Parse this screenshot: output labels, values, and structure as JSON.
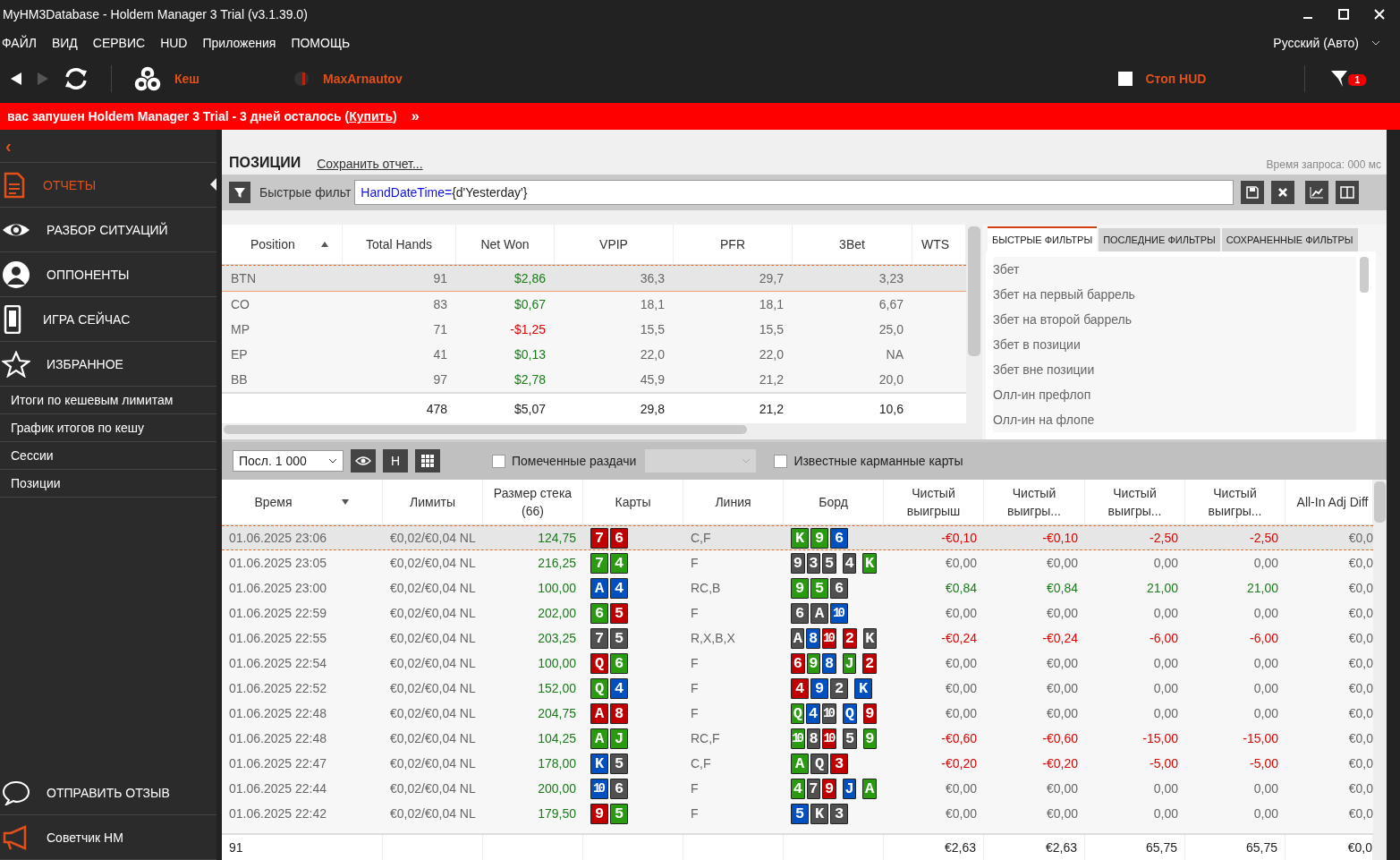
{
  "window": {
    "title": "MyHM3Database - Holdem Manager 3 Trial (v3.1.39.0)"
  },
  "menu": [
    "ФАЙЛ",
    "ВИД",
    "СЕРВИС",
    "HUD",
    "Приложения",
    "ПОМОЩЬ"
  ],
  "language": "Русский (Авто)",
  "toolbar": {
    "game_type": "Кеш",
    "player": "MaxArnautov",
    "stop_hud": {
      "label": "Стоп HUD",
      "checked": false
    },
    "filter_badge": "1"
  },
  "banner": {
    "text": "вас запушен Holdem Manager 3 Trial - 3 дней осталось (",
    "link": "Купить",
    "suffix": ")",
    "more": "»"
  },
  "sidebar": {
    "back": "‹",
    "items": [
      {
        "label": "ОТЧЕТЫ",
        "selected": true
      },
      {
        "label": "РАЗБОР СИТУАЦИЙ",
        "selected": false
      },
      {
        "label": "ОППОНЕНТЫ",
        "selected": false
      },
      {
        "label": "ИГРА СЕЙЧАС",
        "selected": false
      },
      {
        "label": "ИЗБРАННОЕ",
        "selected": false
      }
    ],
    "reports": [
      {
        "label": "Итоги по кешевым лимитам",
        "selected": false
      },
      {
        "label": "График итогов по кешу",
        "selected": false
      },
      {
        "label": "Сессии",
        "selected": false
      },
      {
        "label": "Позиции",
        "selected": false
      }
    ],
    "bottom": [
      {
        "label": "ОТПРАВИТЬ ОТЗЫВ"
      },
      {
        "label": "Советчик HM"
      }
    ]
  },
  "report": {
    "title": "ПОЗИЦИИ",
    "save_link": "Сохранить отчет...",
    "query_time": "Время запроса: 000 мс",
    "filter": {
      "label": "Быстрые фильт",
      "field": "HandDateTime=",
      "value": " {d'Yesterday'}"
    }
  },
  "positions": {
    "columns": [
      {
        "label": "Position",
        "sorted": true,
        "descending": false
      },
      {
        "label": "Total Hands"
      },
      {
        "label": "Net Won"
      },
      {
        "label": "VPIP"
      },
      {
        "label": "PFR"
      },
      {
        "label": "3Bet"
      },
      {
        "label": "WTS"
      }
    ],
    "rows": [
      {
        "position": "BTN",
        "total_hands": "91",
        "net_won": "$2,86",
        "vpip": "36,3",
        "pfr": "29,7",
        "three_bet": "3,23",
        "color": "#1a7a1a",
        "selected": true
      },
      {
        "position": "CO",
        "total_hands": "83",
        "net_won": "$0,67",
        "vpip": "18,1",
        "pfr": "18,1",
        "three_bet": "6,67",
        "color": "#1a7a1a",
        "selected": false
      },
      {
        "position": "MP",
        "total_hands": "71",
        "net_won": "-$1,25",
        "vpip": "15,5",
        "pfr": "15,5",
        "three_bet": "25,0",
        "color": "#e00000",
        "selected": false
      },
      {
        "position": "EP",
        "total_hands": "41",
        "net_won": "$0,13",
        "vpip": "22,0",
        "pfr": "22,0",
        "three_bet": "NA",
        "color": "#1a7a1a",
        "selected": false
      },
      {
        "position": "BB",
        "total_hands": "97",
        "net_won": "$2,78",
        "vpip": "45,9",
        "pfr": "21,2",
        "three_bet": "20,0",
        "color": "#1a7a1a",
        "selected": false
      }
    ],
    "totals": {
      "total_hands": "478",
      "net_won": "$5,07",
      "vpip": "29,8",
      "pfr": "21,2",
      "three_bet": "10,6"
    }
  },
  "filter_panel": {
    "tabs": [
      {
        "label": "БЫСТРЫЕ ФИЛЬТРЫ",
        "selected": true
      },
      {
        "label": "ПОСЛЕДНИЕ ФИЛЬТРЫ",
        "selected": false
      },
      {
        "label": "СОХРАНЕННЫЕ ФИЛЬТРЫ",
        "selected": false
      }
    ],
    "items": [
      "3бет",
      "3бет на первый баррель",
      "3бет на второй баррель",
      "3бет в позиции",
      "3бет вне позиции",
      "Олл-ин префлоп",
      "Олл-ин на флопе"
    ]
  },
  "hands_toolbar": {
    "range": "Посл. 1 000",
    "h_button": "H",
    "marked": {
      "label": "Помеченные раздачи",
      "checked": false
    },
    "known_cards": {
      "label": "Известные карманные карты",
      "checked": false
    }
  },
  "hands": {
    "columns": [
      {
        "label": "Время",
        "sorted": true,
        "descending": true
      },
      {
        "label": "Лимиты"
      },
      {
        "label": "Размер стека (66)"
      },
      {
        "label": "Карты"
      },
      {
        "label": "Линия"
      },
      {
        "label": "Борд"
      },
      {
        "label": "Чистый выигрыш"
      },
      {
        "label": "Чистый выигры..."
      },
      {
        "label": "Чистый выигры..."
      },
      {
        "label": "Чистый выигры..."
      },
      {
        "label": "All-In Adj Diff"
      }
    ],
    "rows": [
      {
        "time": "01.06.2025 23:06",
        "limits": "€0,02/€0,04 NL",
        "stack": "124,75",
        "hole_cards": [
          {
            "rank": "7",
            "color": "#c00000"
          },
          {
            "rank": "6",
            "color": "#c00000"
          }
        ],
        "line": "C,F",
        "board": [
          {
            "rank": "K",
            "color": "#2a9a10"
          },
          {
            "rank": "9",
            "color": "#2a9a10"
          },
          {
            "rank": "6",
            "color": "#0050c0"
          }
        ],
        "net_won": [
          "-€0,10",
          "-€0,10",
          "-2,50",
          "-2,50"
        ],
        "all_in_adj_diff": "€0,0",
        "color": "#e00000",
        "selected": true
      },
      {
        "time": "01.06.2025 23:05",
        "limits": "€0,02/€0,04 NL",
        "stack": "216,25",
        "hole_cards": [
          {
            "rank": "7",
            "color": "#2a9a10"
          },
          {
            "rank": "4",
            "color": "#2a9a10"
          }
        ],
        "line": "F",
        "board": [
          {
            "rank": "9",
            "color": "#505050"
          },
          {
            "rank": "3",
            "color": "#505050"
          },
          {
            "rank": "5",
            "color": "#505050"
          },
          {
            "rank": "4",
            "color": "#505050"
          },
          {
            "rank": "K",
            "color": "#2a9a10"
          }
        ],
        "net_won": [
          "€0,00",
          "€0,00",
          "0,00",
          "0,00"
        ],
        "all_in_adj_diff": "€0,0",
        "color": "#666666",
        "selected": false
      },
      {
        "time": "01.06.2025 23:00",
        "limits": "€0,02/€0,04 NL",
        "stack": "100,00",
        "hole_cards": [
          {
            "rank": "A",
            "color": "#0050c0"
          },
          {
            "rank": "4",
            "color": "#0050c0"
          }
        ],
        "line": "RC,B",
        "board": [
          {
            "rank": "9",
            "color": "#2a9a10"
          },
          {
            "rank": "5",
            "color": "#2a9a10"
          },
          {
            "rank": "6",
            "color": "#505050"
          }
        ],
        "net_won": [
          "€0,84",
          "€0,84",
          "21,00",
          "21,00"
        ],
        "all_in_adj_diff": "€0,0",
        "color": "#1a7a1a",
        "selected": false
      },
      {
        "time": "01.06.2025 22:59",
        "limits": "€0,02/€0,04 NL",
        "stack": "202,00",
        "hole_cards": [
          {
            "rank": "6",
            "color": "#2a9a10"
          },
          {
            "rank": "5",
            "color": "#c00000"
          }
        ],
        "line": "F",
        "board": [
          {
            "rank": "6",
            "color": "#505050"
          },
          {
            "rank": "A",
            "color": "#505050"
          },
          {
            "rank": "10",
            "color": "#0050c0"
          }
        ],
        "net_won": [
          "€0,00",
          "€0,00",
          "0,00",
          "0,00"
        ],
        "all_in_adj_diff": "€0,0",
        "color": "#666666",
        "selected": false
      },
      {
        "time": "01.06.2025 22:55",
        "limits": "€0,02/€0,04 NL",
        "stack": "203,25",
        "hole_cards": [
          {
            "rank": "7",
            "color": "#505050"
          },
          {
            "rank": "5",
            "color": "#505050"
          }
        ],
        "line": "R,X,B,X",
        "board": [
          {
            "rank": "A",
            "color": "#505050"
          },
          {
            "rank": "8",
            "color": "#0050c0"
          },
          {
            "rank": "10",
            "color": "#c00000"
          },
          {
            "rank": "2",
            "color": "#c00000"
          },
          {
            "rank": "K",
            "color": "#505050"
          }
        ],
        "net_won": [
          "-€0,24",
          "-€0,24",
          "-6,00",
          "-6,00"
        ],
        "all_in_adj_diff": "€0,0",
        "color": "#e00000",
        "selected": false
      },
      {
        "time": "01.06.2025 22:54",
        "limits": "€0,02/€0,04 NL",
        "stack": "100,00",
        "hole_cards": [
          {
            "rank": "Q",
            "color": "#c00000"
          },
          {
            "rank": "6",
            "color": "#2a9a10"
          }
        ],
        "line": "F",
        "board": [
          {
            "rank": "6",
            "color": "#c00000"
          },
          {
            "rank": "9",
            "color": "#2a9a10"
          },
          {
            "rank": "8",
            "color": "#0050c0"
          },
          {
            "rank": "J",
            "color": "#2a9a10"
          },
          {
            "rank": "2",
            "color": "#c00000"
          }
        ],
        "net_won": [
          "€0,00",
          "€0,00",
          "0,00",
          "0,00"
        ],
        "all_in_adj_diff": "€0,0",
        "color": "#666666",
        "selected": false
      },
      {
        "time": "01.06.2025 22:52",
        "limits": "€0,02/€0,04 NL",
        "stack": "152,00",
        "hole_cards": [
          {
            "rank": "Q",
            "color": "#2a9a10"
          },
          {
            "rank": "4",
            "color": "#0050c0"
          }
        ],
        "line": "F",
        "board": [
          {
            "rank": "4",
            "color": "#c00000"
          },
          {
            "rank": "9",
            "color": "#0050c0"
          },
          {
            "rank": "2",
            "color": "#505050"
          },
          {
            "rank": "K",
            "color": "#0050c0"
          }
        ],
        "net_won": [
          "€0,00",
          "€0,00",
          "0,00",
          "0,00"
        ],
        "all_in_adj_diff": "€0,0",
        "color": "#666666",
        "selected": false
      },
      {
        "time": "01.06.2025 22:48",
        "limits": "€0,02/€0,04 NL",
        "stack": "204,75",
        "hole_cards": [
          {
            "rank": "A",
            "color": "#c00000"
          },
          {
            "rank": "8",
            "color": "#c00000"
          }
        ],
        "line": "F",
        "board": [
          {
            "rank": "Q",
            "color": "#2a9a10"
          },
          {
            "rank": "4",
            "color": "#0050c0"
          },
          {
            "rank": "10",
            "color": "#505050"
          },
          {
            "rank": "Q",
            "color": "#0050c0"
          },
          {
            "rank": "9",
            "color": "#c00000"
          }
        ],
        "net_won": [
          "€0,00",
          "€0,00",
          "0,00",
          "0,00"
        ],
        "all_in_adj_diff": "€0,0",
        "color": "#666666",
        "selected": false
      },
      {
        "time": "01.06.2025 22:48",
        "limits": "€0,02/€0,04 NL",
        "stack": "104,25",
        "hole_cards": [
          {
            "rank": "A",
            "color": "#2a9a10"
          },
          {
            "rank": "J",
            "color": "#2a9a10"
          }
        ],
        "line": "RC,F",
        "board": [
          {
            "rank": "10",
            "color": "#2a9a10"
          },
          {
            "rank": "8",
            "color": "#505050"
          },
          {
            "rank": "10",
            "color": "#c00000"
          },
          {
            "rank": "5",
            "color": "#505050"
          },
          {
            "rank": "9",
            "color": "#2a9a10"
          }
        ],
        "net_won": [
          "-€0,60",
          "-€0,60",
          "-15,00",
          "-15,00"
        ],
        "all_in_adj_diff": "€0,0",
        "color": "#e00000",
        "selected": false
      },
      {
        "time": "01.06.2025 22:47",
        "limits": "€0,02/€0,04 NL",
        "stack": "178,00",
        "hole_cards": [
          {
            "rank": "K",
            "color": "#0050c0"
          },
          {
            "rank": "5",
            "color": "#505050"
          }
        ],
        "line": "C,F",
        "board": [
          {
            "rank": "A",
            "color": "#2a9a10"
          },
          {
            "rank": "Q",
            "color": "#505050"
          },
          {
            "rank": "3",
            "color": "#c00000"
          }
        ],
        "net_won": [
          "-€0,20",
          "-€0,20",
          "-5,00",
          "-5,00"
        ],
        "all_in_adj_diff": "€0,0",
        "color": "#e00000",
        "selected": false
      },
      {
        "time": "01.06.2025 22:44",
        "limits": "€0,02/€0,04 NL",
        "stack": "200,00",
        "hole_cards": [
          {
            "rank": "10",
            "color": "#0050c0"
          },
          {
            "rank": "6",
            "color": "#505050"
          }
        ],
        "line": "F",
        "board": [
          {
            "rank": "4",
            "color": "#2a9a10"
          },
          {
            "rank": "7",
            "color": "#505050"
          },
          {
            "rank": "9",
            "color": "#c00000"
          },
          {
            "rank": "J",
            "color": "#0050c0"
          },
          {
            "rank": "A",
            "color": "#2a9a10"
          }
        ],
        "net_won": [
          "€0,00",
          "€0,00",
          "0,00",
          "0,00"
        ],
        "all_in_adj_diff": "€0,0",
        "color": "#666666",
        "selected": false
      },
      {
        "time": "01.06.2025 22:42",
        "limits": "€0,02/€0,04 NL",
        "stack": "179,50",
        "hole_cards": [
          {
            "rank": "9",
            "color": "#c00000"
          },
          {
            "rank": "5",
            "color": "#2a9a10"
          }
        ],
        "line": "F",
        "board": [
          {
            "rank": "5",
            "color": "#0050c0"
          },
          {
            "rank": "K",
            "color": "#505050"
          },
          {
            "rank": "3",
            "color": "#505050"
          }
        ],
        "net_won": [
          "€0,00",
          "€0,00",
          "0,00",
          "0,00"
        ],
        "all_in_adj_diff": "€0,0",
        "color": "#666666",
        "selected": false
      }
    ],
    "totals": {
      "count": "91",
      "net_won": [
        "€2,63",
        "€2,63",
        "65,75",
        "65,75"
      ],
      "all_in_adj_diff": "€0,0"
    }
  }
}
